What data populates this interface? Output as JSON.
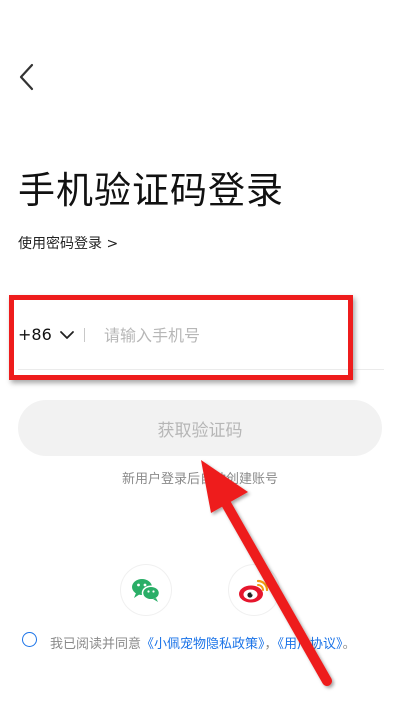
{
  "header": {
    "back_icon": "chevron-left-icon"
  },
  "title": "手机验证码登录",
  "password_login_link": "使用密码登录 >",
  "phone_field": {
    "country_code": "+86",
    "dropdown_icon": "chevron-down-icon",
    "divider": "|",
    "placeholder": "请输入手机号",
    "value": ""
  },
  "get_code_button": "获取验证码",
  "new_user_hint": "新用户登录后自动创建账号",
  "social_login": [
    {
      "name": "wechat",
      "icon": "wechat-icon",
      "color": "#2aae67"
    },
    {
      "name": "weibo",
      "icon": "weibo-icon",
      "color": "#e6162d"
    }
  ],
  "agreement": {
    "checked": false,
    "prefix": "我已阅读并同意",
    "privacy_link": "《小佩宠物隐私政策》",
    "separator": "，",
    "user_link": "《用户协议》",
    "suffix": "。"
  },
  "annotation": {
    "highlight_color": "#ee1c1c"
  }
}
